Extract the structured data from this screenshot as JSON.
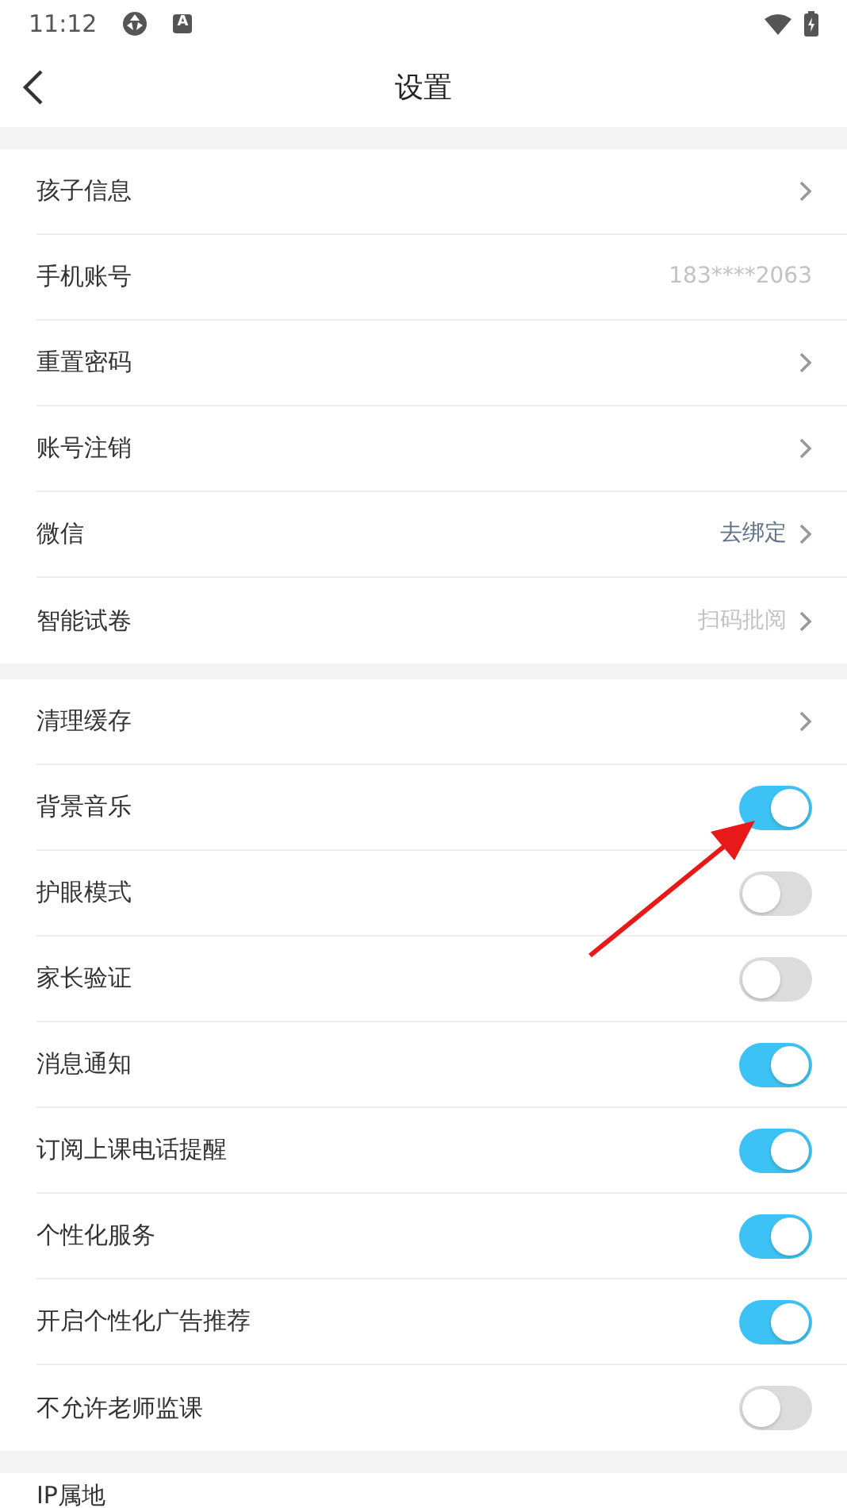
{
  "status_bar": {
    "time": "11:12",
    "badge_letter": "A"
  },
  "header": {
    "title": "设置"
  },
  "groups": [
    {
      "rows": [
        {
          "kind": "link",
          "label": "孩子信息"
        },
        {
          "kind": "value",
          "label": "手机账号",
          "value": "183****2063",
          "muted": true
        },
        {
          "kind": "link",
          "label": "重置密码"
        },
        {
          "kind": "link",
          "label": "账号注销"
        },
        {
          "kind": "link",
          "label": "微信",
          "value": "去绑定",
          "muted": false
        },
        {
          "kind": "link",
          "label": "智能试卷",
          "value": "扫码批阅",
          "muted": true
        }
      ]
    },
    {
      "rows": [
        {
          "kind": "link",
          "label": "清理缓存"
        },
        {
          "kind": "toggle",
          "label": "背景音乐",
          "on": true
        },
        {
          "kind": "toggle",
          "label": "护眼模式",
          "on": false
        },
        {
          "kind": "toggle",
          "label": "家长验证",
          "on": false
        },
        {
          "kind": "toggle",
          "label": "消息通知",
          "on": true
        },
        {
          "kind": "toggle",
          "label": "订阅上课电话提醒",
          "on": true
        },
        {
          "kind": "toggle",
          "label": "个性化服务",
          "on": true
        },
        {
          "kind": "toggle",
          "label": "开启个性化广告推荐",
          "on": true
        },
        {
          "kind": "toggle",
          "label": "不允许老师监课",
          "on": false
        }
      ]
    },
    {
      "rows": [
        {
          "kind": "label",
          "label": "IP属地"
        }
      ]
    }
  ]
}
